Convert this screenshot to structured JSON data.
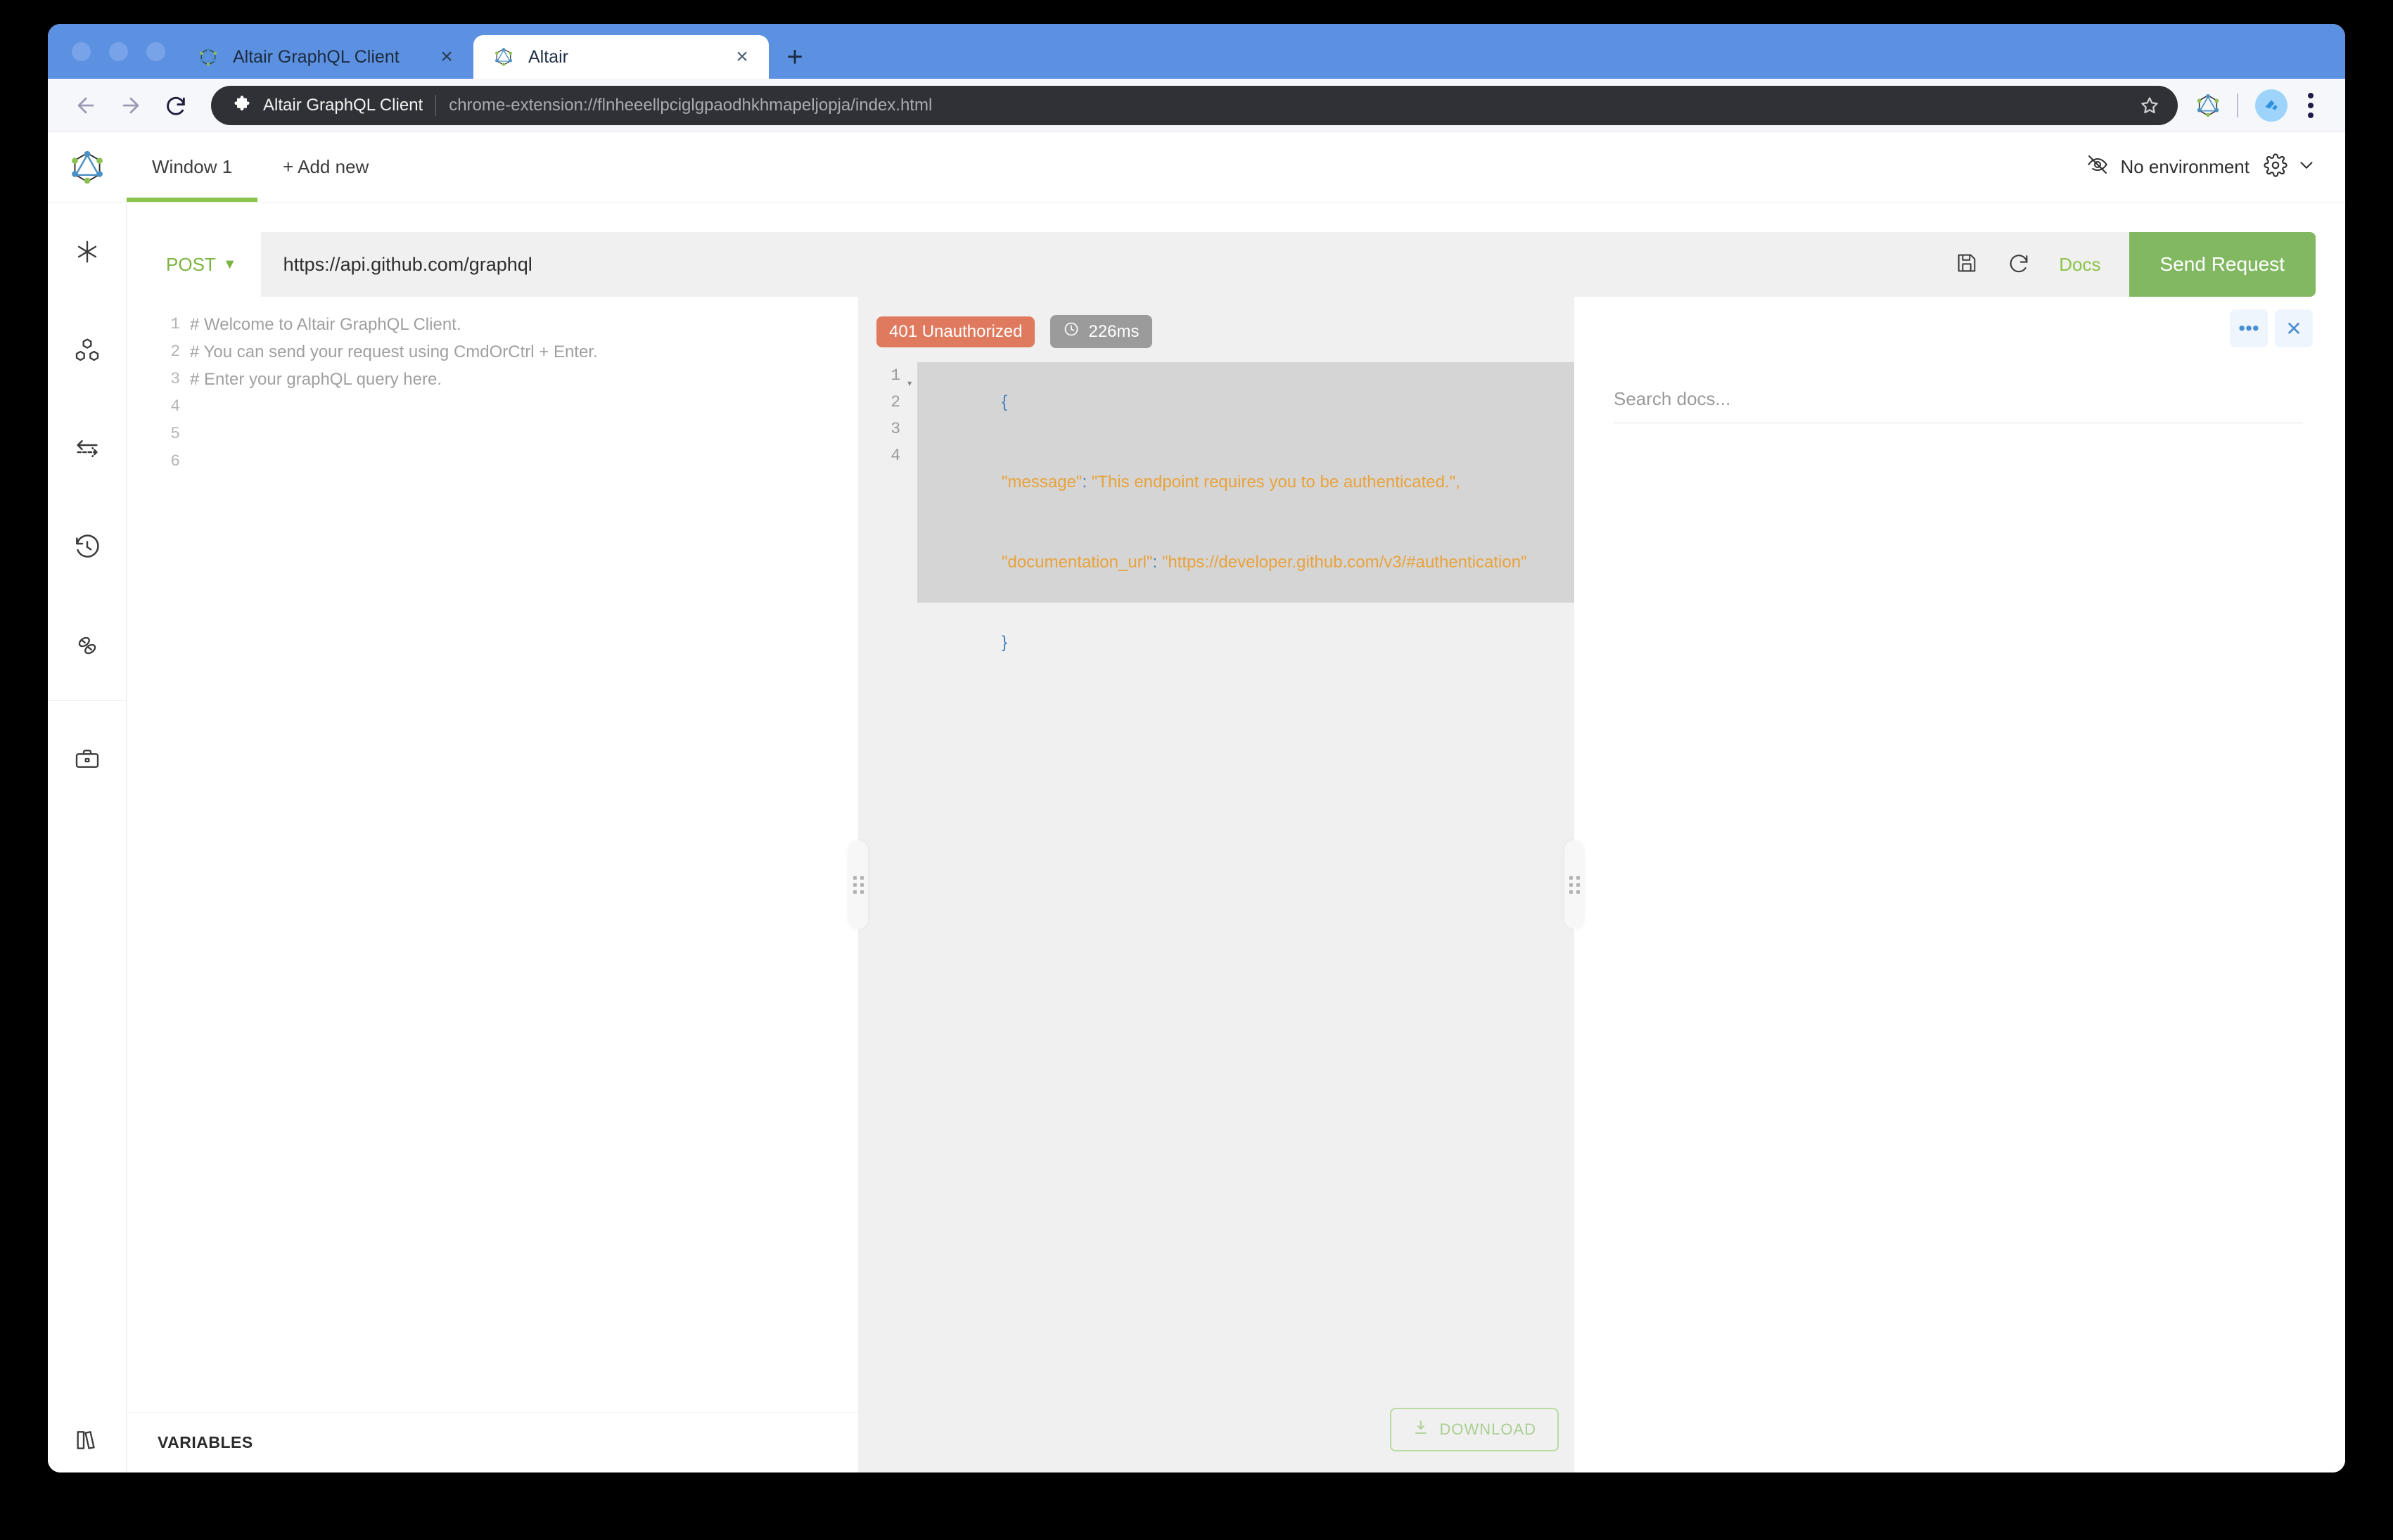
{
  "browser": {
    "tabs": [
      {
        "title": "Altair GraphQL Client",
        "active": false,
        "favicon": "graphql-logo-icon",
        "close_label": "×"
      },
      {
        "title": "Altair",
        "active": true,
        "favicon": "graphql-logo-icon",
        "close_label": "×"
      }
    ],
    "new_tab_label": "+",
    "nav": {
      "back": "←",
      "forward": "→",
      "reload": "↻"
    },
    "omnibox": {
      "extension_name": "Altair GraphQL Client",
      "url": "chrome-extension://flnheeellpciglgpaodhkhmapeljopja/index.html",
      "star_label": "☆"
    },
    "toolbar_icons": [
      "graphql-extension-icon",
      "profile-avatar-icon",
      "chrome-menu-icon"
    ]
  },
  "app": {
    "logo": "altair-graphql-logo",
    "window_tabs": [
      {
        "label": "Window 1",
        "active": true
      }
    ],
    "add_new_label": "+ Add new",
    "environment": {
      "label": "No environment",
      "icon": "eye-slash-icon"
    },
    "settings": {
      "gear_icon": "gear-icon",
      "caret": "⌄"
    },
    "sidebar": [
      {
        "name": "docs-star-icon"
      },
      {
        "name": "collections-cubes-icon"
      },
      {
        "name": "pre-post-request-arrows-icon"
      },
      {
        "name": "history-clock-icon"
      },
      {
        "name": "plugins-dna-icon"
      },
      {
        "name": "toolbox-briefcase-icon"
      }
    ],
    "sidebar_bottom": {
      "name": "variables-book-icon"
    },
    "request": {
      "method": "POST",
      "method_caret": "▼",
      "url": "https://api.github.com/graphql",
      "save_icon": "save-floppy-icon",
      "reload_icon": "reload-icon",
      "docs_label": "Docs",
      "send_label": "Send Request"
    },
    "query_editor": {
      "line_numbers": [
        "1",
        "2",
        "3",
        "4",
        "5",
        "6"
      ],
      "lines": [
        "",
        "# Welcome to Altair GraphQL Client.",
        "# You can send your request using CmdOrCtrl + Enter.",
        "",
        "# Enter your graphQL query here.",
        ""
      ]
    },
    "variables_label": "VARIABLES",
    "response": {
      "status_text": "401 Unauthorized",
      "status_color": "#e07a5f",
      "time_text": "226ms",
      "time_icon": "clock-icon",
      "line_numbers": [
        "1",
        "2",
        "3",
        "4"
      ],
      "body_lines": [
        {
          "num": "1",
          "text": "{",
          "type": "brace",
          "selected": true,
          "fold": "▾"
        },
        {
          "num": "2",
          "key": "\"message\"",
          "colon": ": ",
          "value": "\"This endpoint requires you to be authenticated.\",",
          "type": "pair",
          "selected": true
        },
        {
          "num": "3",
          "key": "\"documentation_url\"",
          "colon": ": ",
          "value": "\"https://developer.github.com/v3/#authentication\"",
          "type": "pair",
          "selected": true
        },
        {
          "num": "4",
          "text": "}",
          "type": "brace",
          "selected": false
        }
      ],
      "download_label": "DOWNLOAD",
      "download_icon": "download-arrow-icon"
    },
    "docs_panel": {
      "more_label": "•••",
      "close_label": "✕",
      "search_placeholder": "Search docs..."
    }
  }
}
